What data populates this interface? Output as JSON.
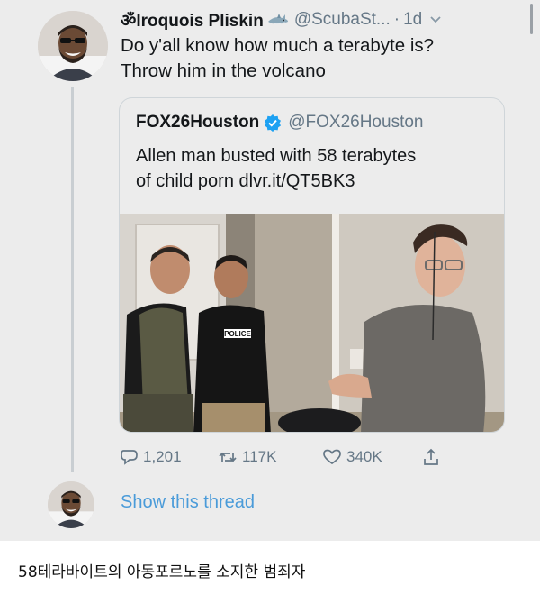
{
  "tweet": {
    "author_name": "ॐIroquois Pliskin",
    "author_handle": "@ScubaSt...",
    "separator": "·",
    "timestamp": "1d",
    "text_lines": [
      "Do y'all know how much a terabyte is?",
      "Throw him in the volcano"
    ],
    "badge_icon": "shark-emoji-icon",
    "menu_icon": "chevron-down-icon"
  },
  "quote": {
    "author_name": "FOX26Houston",
    "author_handle": "@FOX26Houston",
    "verified_icon": "verified-badge-icon",
    "text_lines": [
      "Allen man busted with 58 terabytes",
      "of child porn dlvr.it/QT5BK3"
    ],
    "photo": {
      "vest_label": "POLICE"
    }
  },
  "actions": {
    "reply_count": "1,201",
    "retweet_count": "117K",
    "like_count": "340K"
  },
  "thread": {
    "show_thread_label": "Show this thread"
  },
  "caption": {
    "text": "58테라바이트의 아동포르노를 소지한 범죄자"
  },
  "colors": {
    "background": "#ececec",
    "link": "#4a9bd9",
    "secondary_text": "#657786",
    "verified": "#1da1f2"
  }
}
